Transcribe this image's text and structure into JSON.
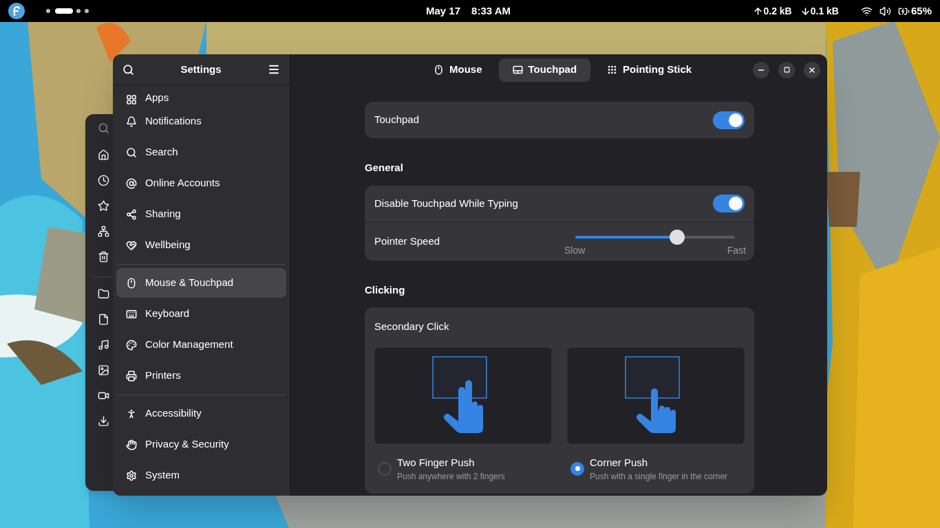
{
  "top_bar": {
    "date": "May 17",
    "time": "8:33 AM",
    "upload": "0.2 kB",
    "download": "0.1 kB",
    "battery": "65%"
  },
  "window": {
    "title": "Settings"
  },
  "sidebar": {
    "groups": [
      {
        "items": [
          {
            "label": "Apps",
            "selected": false
          },
          {
            "label": "Notifications",
            "selected": false
          },
          {
            "label": "Search",
            "selected": false
          },
          {
            "label": "Online Accounts",
            "selected": false
          },
          {
            "label": "Sharing",
            "selected": false
          },
          {
            "label": "Wellbeing",
            "selected": false
          }
        ]
      },
      {
        "items": [
          {
            "label": "Mouse & Touchpad",
            "selected": true
          },
          {
            "label": "Keyboard",
            "selected": false
          },
          {
            "label": "Color Management",
            "selected": false
          },
          {
            "label": "Printers",
            "selected": false
          }
        ]
      },
      {
        "items": [
          {
            "label": "Accessibility",
            "selected": false
          },
          {
            "label": "Privacy & Security",
            "selected": false
          },
          {
            "label": "System",
            "selected": false
          }
        ]
      }
    ]
  },
  "tabs": [
    {
      "label": "Mouse",
      "selected": false
    },
    {
      "label": "Touchpad",
      "selected": true
    },
    {
      "label": "Pointing Stick",
      "selected": false
    }
  ],
  "touchpad": {
    "label": "Touchpad",
    "on": true
  },
  "general": {
    "heading": "General",
    "disable_while_typing": {
      "label": "Disable Touchpad While Typing",
      "on": true
    },
    "pointer_speed": {
      "label": "Pointer Speed",
      "level": 0.64,
      "min_label": "Slow",
      "max_label": "Fast"
    }
  },
  "clicking": {
    "heading": "Clicking",
    "secondary_click": {
      "title": "Secondary Click",
      "options": [
        {
          "label": "Two Finger Push",
          "description": "Push anywhere with 2 fingers",
          "selected": false
        },
        {
          "label": "Corner Push",
          "description": "Push with a single finger in the corner",
          "selected": true
        }
      ]
    }
  }
}
